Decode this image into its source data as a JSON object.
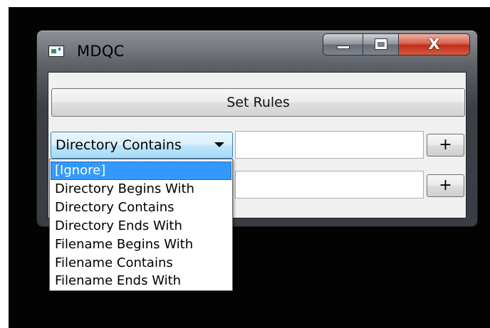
{
  "window": {
    "title": "MDQC",
    "icon": "app-icon",
    "caption_buttons": {
      "minimize_icon": "minimize-icon",
      "maximize_icon": "maximize-icon",
      "close_glyph": "X"
    }
  },
  "toolbar": {
    "set_rules_label": "Set Rules"
  },
  "rules": [
    {
      "selector_value": "Directory Contains",
      "text_value": "",
      "add_label": "+"
    },
    {
      "selector_value": "",
      "text_value": "",
      "add_label": "+"
    }
  ],
  "dropdown": {
    "selected_index": 0,
    "items": [
      "[Ignore]",
      "Directory Begins With",
      "Directory Contains",
      "Directory Ends With",
      "Filename Begins With",
      "Filename Contains",
      "Filename Ends With"
    ]
  },
  "colors": {
    "selection": "#3399ff",
    "combo_focus": "#bee6fd",
    "close_button": "#c7321c",
    "desktop": "#030303"
  }
}
